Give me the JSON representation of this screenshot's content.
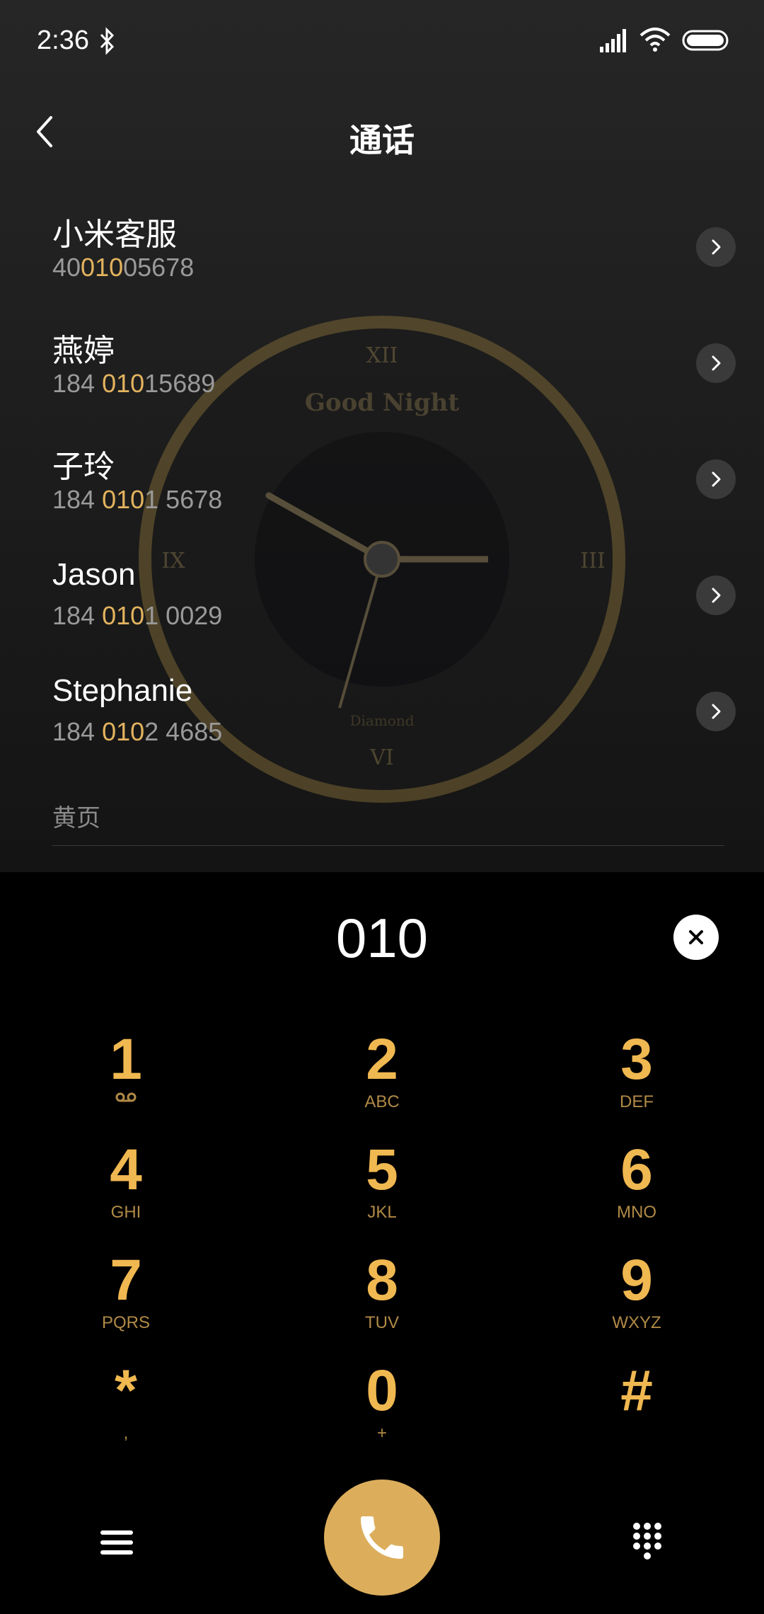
{
  "status_bar": {
    "time": "2:36"
  },
  "header": {
    "title": "通话"
  },
  "contacts": [
    {
      "name": "小米客服",
      "number": [
        {
          "t": "40"
        },
        {
          "t": "010",
          "hl": true
        },
        {
          "t": "05678"
        }
      ]
    },
    {
      "name": "燕婷",
      "number": [
        {
          "t": "184 "
        },
        {
          "t": "010",
          "hl": true
        },
        {
          "t": "15689"
        }
      ]
    },
    {
      "name": "子玲",
      "number": [
        {
          "t": "184 "
        },
        {
          "t": "010",
          "hl": true
        },
        {
          "t": "1 5678"
        }
      ]
    },
    {
      "name": "Jason",
      "number": [
        {
          "t": "184 "
        },
        {
          "t": "010",
          "hl": true
        },
        {
          "t": "1 0029"
        }
      ]
    },
    {
      "name": "Stephanie",
      "number": [
        {
          "t": "184 "
        },
        {
          "t": "010",
          "hl": true
        },
        {
          "t": "2 4685"
        }
      ]
    }
  ],
  "section": {
    "yellow_pages": "黄页"
  },
  "dialer": {
    "input": "010"
  },
  "keypad": [
    {
      "digit": "1",
      "letters": ""
    },
    {
      "digit": "2",
      "letters": "ABC"
    },
    {
      "digit": "3",
      "letters": "DEF"
    },
    {
      "digit": "4",
      "letters": "GHI"
    },
    {
      "digit": "5",
      "letters": "JKL"
    },
    {
      "digit": "6",
      "letters": "MNO"
    },
    {
      "digit": "7",
      "letters": "PQRS"
    },
    {
      "digit": "8",
      "letters": "TUV"
    },
    {
      "digit": "9",
      "letters": "WXYZ"
    },
    {
      "digit": "*",
      "letters": ","
    },
    {
      "digit": "0",
      "letters": "+"
    },
    {
      "digit": "#",
      "letters": ""
    }
  ],
  "clock_wallpaper": {
    "title": "Good Night",
    "subtitle": "Diamond"
  },
  "colors": {
    "accent": "#f0b850",
    "call_button": "#dcae5c",
    "number_highlight": "#e3b35e"
  },
  "icons": {
    "status": [
      "bluetooth-icon",
      "signal-icon",
      "wifi-icon",
      "battery-icon"
    ],
    "nav": "back-arrow-icon",
    "row": "chevron-right-icon",
    "bottom": [
      "menu-icon",
      "phone-icon",
      "keypad-grid-icon"
    ],
    "voicemail": "voicemail-icon",
    "clear": "close-icon"
  }
}
